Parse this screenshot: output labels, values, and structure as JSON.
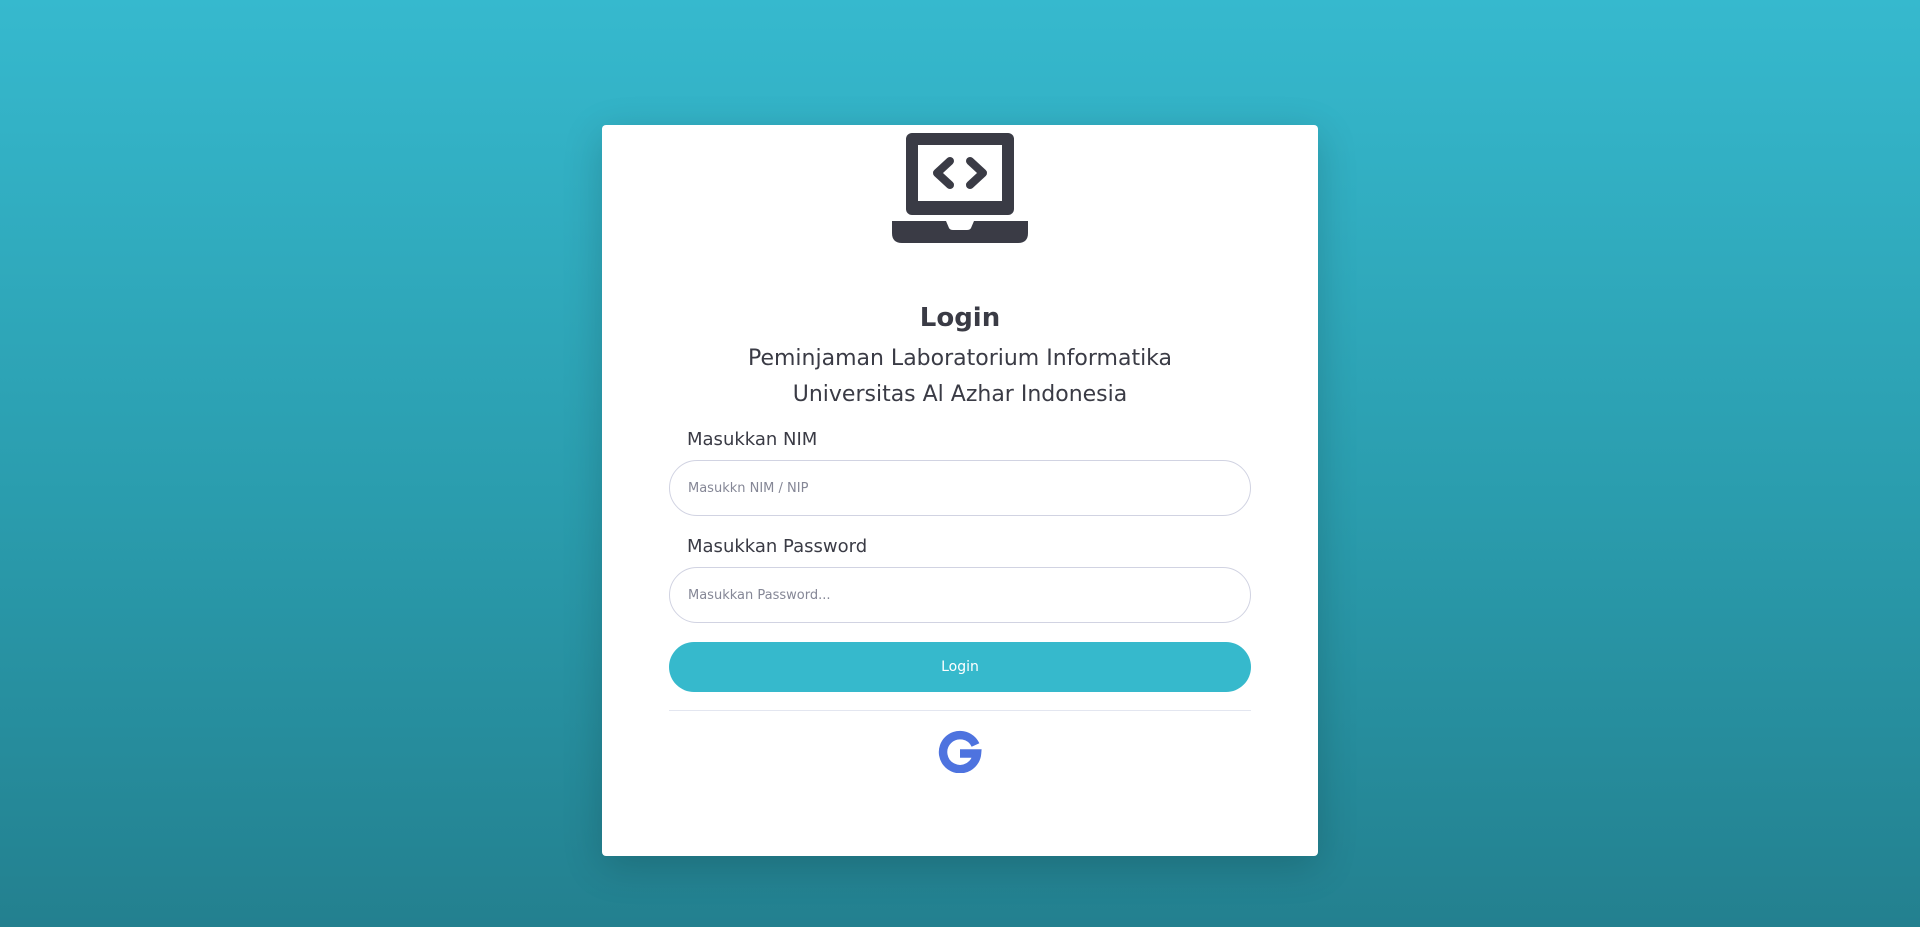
{
  "login": {
    "title": "Login",
    "subtitle_line1": "Peminjaman Laboratorium Informatika",
    "subtitle_line2": "Universitas Al Azhar Indonesia",
    "nim_label": "Masukkan NIM",
    "nim_placeholder": "Masukkn NIM / NIP",
    "password_label": "Masukkan Password",
    "password_placeholder": "Masukkan Password...",
    "submit_label": "Login",
    "logo_icon": "laptop-code-icon",
    "google_icon": "google-icon"
  },
  "colors": {
    "background_top": "#36b9ce",
    "background_bottom": "#23808f",
    "accent": "#36b9cc",
    "google_blue": "#4e73df",
    "icon_dark": "#3a3b45"
  }
}
